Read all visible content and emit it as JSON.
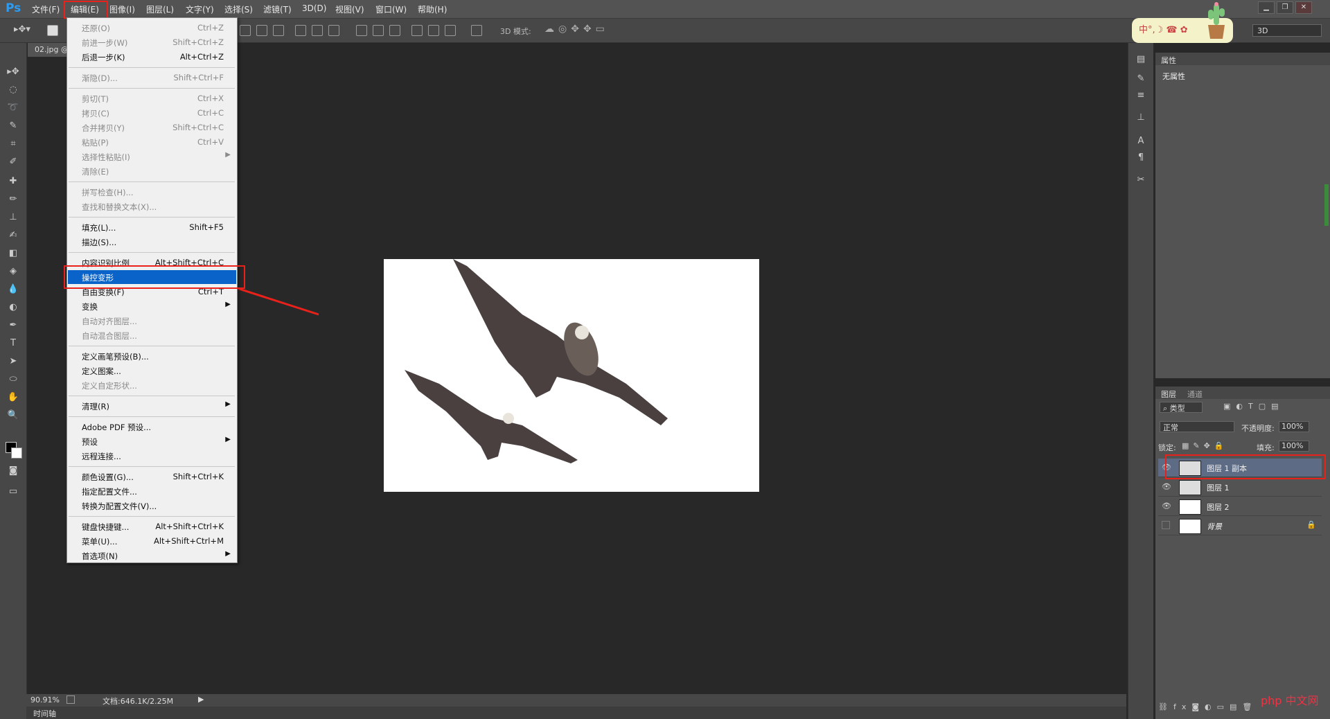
{
  "app": {
    "logo": "Ps"
  },
  "menubar": [
    {
      "label": "文件(F)"
    },
    {
      "label": "编辑(E)"
    },
    {
      "label": "图像(I)"
    },
    {
      "label": "图层(L)"
    },
    {
      "label": "文字(Y)"
    },
    {
      "label": "选择(S)"
    },
    {
      "label": "滤镜(T)"
    },
    {
      "label": "3D(D)"
    },
    {
      "label": "视图(V)"
    },
    {
      "label": "窗口(W)"
    },
    {
      "label": "帮助(H)"
    }
  ],
  "options": {
    "mode3d_label": "3D 模式:",
    "workspace": "3D"
  },
  "ime": {
    "text": "中°,☽ ☎ ✿"
  },
  "document": {
    "tab": "02.jpg @"
  },
  "edit_menu": [
    {
      "label": "还原(O)",
      "shortcut": "Ctrl+Z",
      "disabled": true
    },
    {
      "label": "前进一步(W)",
      "shortcut": "Shift+Ctrl+Z",
      "disabled": true
    },
    {
      "label": "后退一步(K)",
      "shortcut": "Alt+Ctrl+Z",
      "disabled": false
    },
    {
      "sep": true
    },
    {
      "label": "渐隐(D)...",
      "shortcut": "Shift+Ctrl+F",
      "disabled": true
    },
    {
      "sep": true
    },
    {
      "label": "剪切(T)",
      "shortcut": "Ctrl+X",
      "disabled": true
    },
    {
      "label": "拷贝(C)",
      "shortcut": "Ctrl+C",
      "disabled": true
    },
    {
      "label": "合并拷贝(Y)",
      "shortcut": "Shift+Ctrl+C",
      "disabled": true
    },
    {
      "label": "粘贴(P)",
      "shortcut": "Ctrl+V",
      "disabled": true
    },
    {
      "label": "选择性粘贴(I)",
      "shortcut": "",
      "disabled": true,
      "submenu": true
    },
    {
      "label": "清除(E)",
      "shortcut": "",
      "disabled": true
    },
    {
      "sep": true
    },
    {
      "label": "拼写检查(H)...",
      "shortcut": "",
      "disabled": true
    },
    {
      "label": "查找和替换文本(X)...",
      "shortcut": "",
      "disabled": true
    },
    {
      "sep": true
    },
    {
      "label": "填充(L)...",
      "shortcut": "Shift+F5",
      "disabled": false
    },
    {
      "label": "描边(S)...",
      "shortcut": "",
      "disabled": false
    },
    {
      "sep": true
    },
    {
      "label": "内容识别比例",
      "shortcut": "Alt+Shift+Ctrl+C",
      "disabled": false
    },
    {
      "label": "操控变形",
      "shortcut": "",
      "disabled": false,
      "selected": true
    },
    {
      "label": "自由变换(F)",
      "shortcut": "Ctrl+T",
      "disabled": false
    },
    {
      "label": "变换",
      "shortcut": "",
      "disabled": false,
      "submenu": true
    },
    {
      "label": "自动对齐图层...",
      "shortcut": "",
      "disabled": true
    },
    {
      "label": "自动混合图层...",
      "shortcut": "",
      "disabled": true
    },
    {
      "sep": true
    },
    {
      "label": "定义画笔预设(B)...",
      "shortcut": "",
      "disabled": false
    },
    {
      "label": "定义图案...",
      "shortcut": "",
      "disabled": false
    },
    {
      "label": "定义自定形状...",
      "shortcut": "",
      "disabled": true
    },
    {
      "sep": true
    },
    {
      "label": "清理(R)",
      "shortcut": "",
      "disabled": false,
      "submenu": true
    },
    {
      "sep": true
    },
    {
      "label": "Adobe PDF 预设...",
      "shortcut": "",
      "disabled": false
    },
    {
      "label": "预设",
      "shortcut": "",
      "disabled": false,
      "submenu": true
    },
    {
      "label": "远程连接...",
      "shortcut": "",
      "disabled": false
    },
    {
      "sep": true
    },
    {
      "label": "颜色设置(G)...",
      "shortcut": "Shift+Ctrl+K",
      "disabled": false
    },
    {
      "label": "指定配置文件...",
      "shortcut": "",
      "disabled": false
    },
    {
      "label": "转换为配置文件(V)...",
      "shortcut": "",
      "disabled": false
    },
    {
      "sep": true
    },
    {
      "label": "键盘快捷键...",
      "shortcut": "Alt+Shift+Ctrl+K",
      "disabled": false
    },
    {
      "label": "菜单(U)...",
      "shortcut": "Alt+Shift+Ctrl+M",
      "disabled": false
    },
    {
      "label": "首选项(N)",
      "shortcut": "",
      "disabled": false,
      "submenu": true
    }
  ],
  "properties": {
    "tab": "属性",
    "empty": "无属性"
  },
  "layers_panel": {
    "tabs": [
      "图层",
      "通道"
    ],
    "filter": "类型",
    "blend_mode": "正常",
    "opacity_label": "不透明度:",
    "opacity": "100%",
    "lock_label": "锁定:",
    "fill_label": "填充:",
    "fill": "100%",
    "layers": [
      {
        "name": "图层 1 副本",
        "selected": true,
        "visible": true,
        "thumb": "transparent"
      },
      {
        "name": "图层 1",
        "selected": false,
        "visible": true,
        "thumb": "transparent"
      },
      {
        "name": "图层 2",
        "selected": false,
        "visible": true,
        "thumb": "white"
      },
      {
        "name": "背景",
        "selected": false,
        "visible": false,
        "thumb": "bird",
        "locked": true
      }
    ]
  },
  "status": {
    "zoom": "90.91%",
    "doc_info": "文档:646.1K/2.25M",
    "timeline": "时间轴"
  },
  "watermark": "php 中文网",
  "colors": {
    "accent": "#0a63c9",
    "highlight": "#e8221b",
    "logo": "#2d9bf0"
  }
}
